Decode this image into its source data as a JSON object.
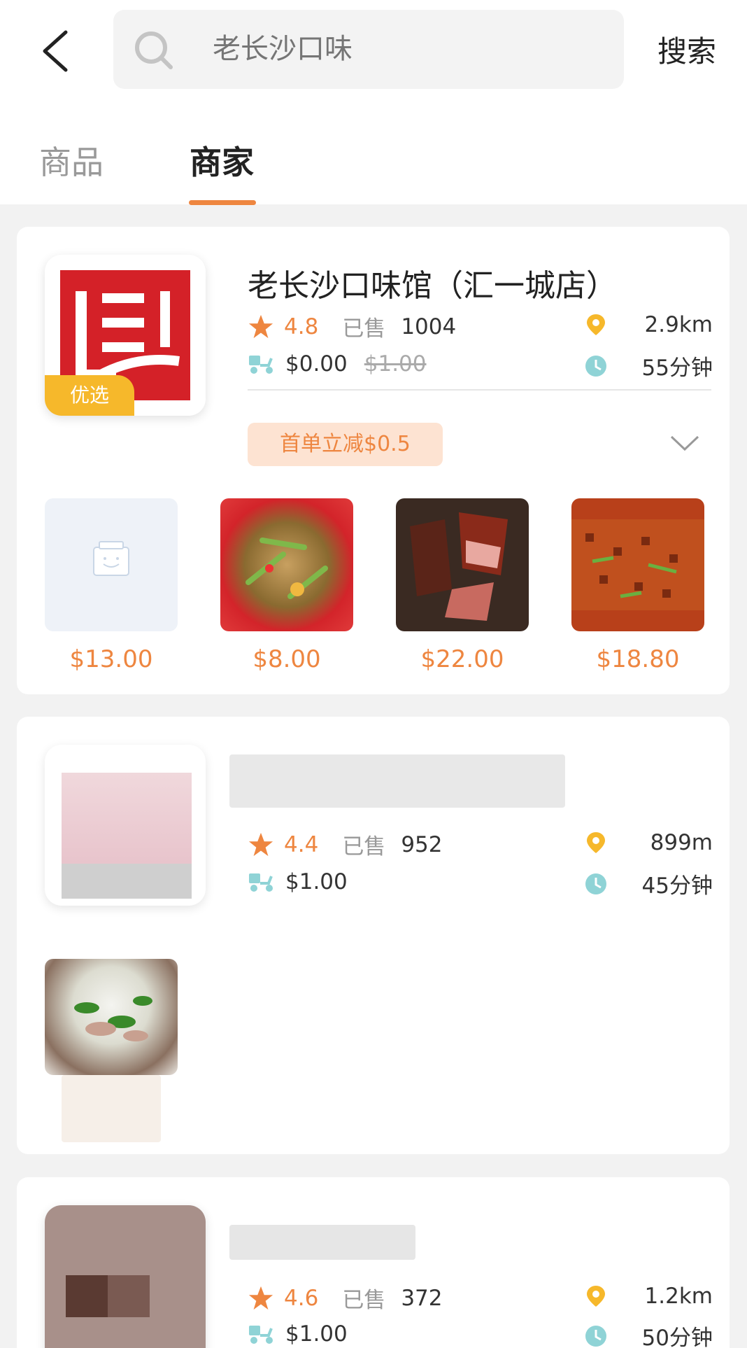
{
  "search": {
    "placeholder": "老长沙口味",
    "button": "搜索"
  },
  "tabs": [
    {
      "label": "商品"
    },
    {
      "label": "商家"
    }
  ],
  "shops": [
    {
      "name": "老长沙口味馆（汇一城店）",
      "badge": "优选",
      "rating": "4.8",
      "sold_label": "已售",
      "sold": "1004",
      "distance": "2.9km",
      "delivery_fee": "$0.00",
      "delivery_fee_original": "$1.00",
      "time": "55分钟",
      "promo": "首单立减$0.5",
      "products": [
        {
          "price": "$13.00",
          "image": "placeholder"
        },
        {
          "price": "$8.00",
          "image": "stir-fry"
        },
        {
          "price": "$22.00",
          "image": "cured-meat"
        },
        {
          "price": "$18.80",
          "image": "spicy-tofu"
        }
      ]
    },
    {
      "rating": "4.4",
      "sold_label": "已售",
      "sold": "952",
      "distance": "899m",
      "delivery_fee": "$1.00",
      "time": "45分钟",
      "products": [
        {
          "image": "noodle-soup"
        }
      ]
    },
    {
      "rating": "4.6",
      "sold_label": "已售",
      "sold": "372",
      "distance": "1.2km",
      "delivery_fee": "$1.00",
      "time": "50分钟"
    }
  ],
  "colors": {
    "accent": "#ee8640",
    "badge": "#f6b82b",
    "promo_bg": "#fde3d2",
    "teal_icon": "#8fd3d6",
    "pin": "#f6b82b"
  }
}
